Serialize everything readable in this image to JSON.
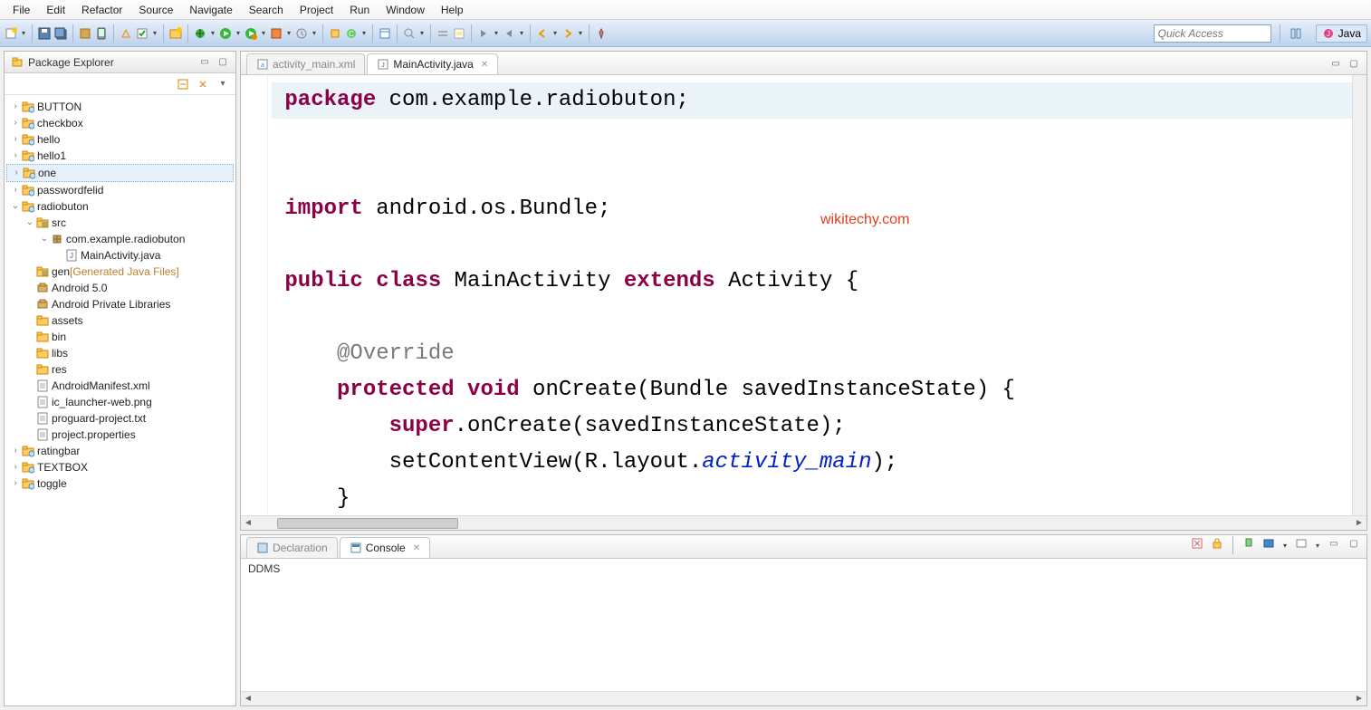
{
  "menu": [
    "File",
    "Edit",
    "Refactor",
    "Source",
    "Navigate",
    "Search",
    "Project",
    "Run",
    "Window",
    "Help"
  ],
  "quick_access_placeholder": "Quick Access",
  "perspective_label": "Java",
  "package_explorer": {
    "title": "Package Explorer",
    "projects": [
      {
        "name": "BUTTON",
        "expanded": false
      },
      {
        "name": "checkbox",
        "expanded": false
      },
      {
        "name": "hello",
        "expanded": false
      },
      {
        "name": "hello1",
        "expanded": false
      },
      {
        "name": "one",
        "expanded": false,
        "selected": true
      },
      {
        "name": "passwordfelid",
        "expanded": false
      },
      {
        "name": "radiobuton",
        "expanded": true,
        "children": [
          {
            "name": "src",
            "kind": "srcfolder",
            "expanded": true,
            "children": [
              {
                "name": "com.example.radiobuton",
                "kind": "package",
                "expanded": true,
                "children": [
                  {
                    "name": "MainActivity.java",
                    "kind": "java"
                  }
                ]
              }
            ]
          },
          {
            "name": "gen",
            "suffix": "[Generated Java Files]",
            "kind": "srcfolder"
          },
          {
            "name": "Android 5.0",
            "kind": "lib"
          },
          {
            "name": "Android Private Libraries",
            "kind": "lib"
          },
          {
            "name": "assets",
            "kind": "folder"
          },
          {
            "name": "bin",
            "kind": "folder"
          },
          {
            "name": "libs",
            "kind": "folder"
          },
          {
            "name": "res",
            "kind": "folder"
          },
          {
            "name": "AndroidManifest.xml",
            "kind": "file"
          },
          {
            "name": "ic_launcher-web.png",
            "kind": "file"
          },
          {
            "name": "proguard-project.txt",
            "kind": "file"
          },
          {
            "name": "project.properties",
            "kind": "file"
          }
        ]
      },
      {
        "name": "ratingbar",
        "expanded": false
      },
      {
        "name": "TEXTBOX",
        "expanded": false
      },
      {
        "name": "toggle",
        "expanded": false
      }
    ]
  },
  "editor": {
    "tabs": [
      {
        "label": "activity_main.xml",
        "active": false,
        "icon": "xml"
      },
      {
        "label": "MainActivity.java",
        "active": true,
        "icon": "java"
      }
    ],
    "watermark": "wikitechy.com",
    "code": {
      "l1_kw": "package",
      "l1_rest": " com.example.radiobuton;",
      "l2_kw": "import",
      "l2_rest": " android.os.Bundle;",
      "l3_kw1": "public",
      "l3_kw2": "class",
      "l3_mid": " MainActivity ",
      "l3_kw3": "extends",
      "l3_rest": " Activity {",
      "l4_ann": "@Override",
      "l5_kw1": "protected",
      "l5_kw2": "void",
      "l5_rest": " onCreate(Bundle savedInstanceState) {",
      "l6_kw": "super",
      "l6_rest": ".onCreate(savedInstanceState);",
      "l7_pre": "setContentView(R.layout.",
      "l7_it": "activity_main",
      "l7_post": ");",
      "l8": "}"
    }
  },
  "console": {
    "tab_declaration": "Declaration",
    "tab_console": "Console",
    "body": "DDMS"
  }
}
